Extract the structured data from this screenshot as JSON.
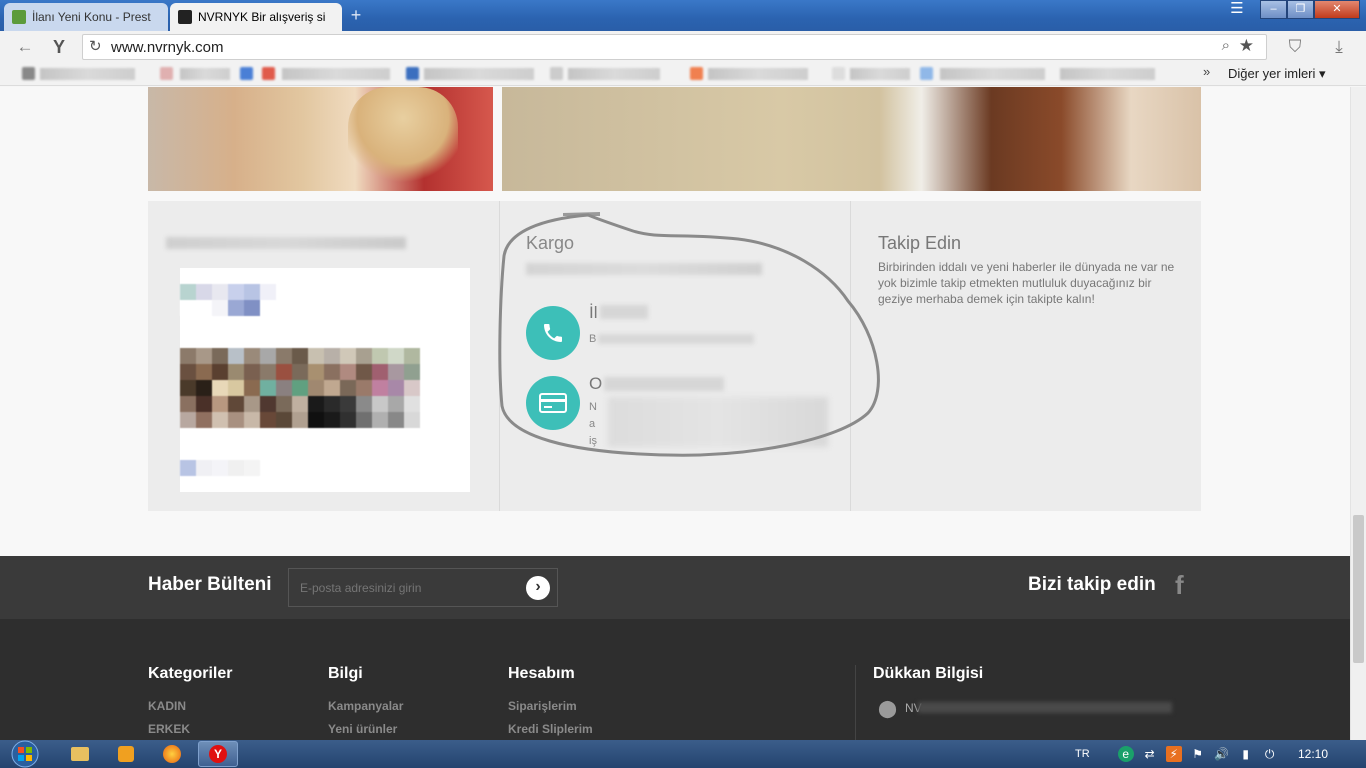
{
  "browser": {
    "tabs": [
      {
        "title": "İlanı Yeni Konu - Prest",
        "active": false
      },
      {
        "title": "NVRNYK Bir alışveriş si",
        "active": true
      }
    ],
    "url": "www.nvrnyk.com",
    "bookmarks_more": "Diğer yer imleri ▾"
  },
  "info": {
    "kargo_title": "Kargo",
    "phone_heading": "İl",
    "phone_text": "B",
    "card_heading": "O",
    "card_lines": [
      "N",
      "a",
      "iş"
    ],
    "takip_title": "Takip Edin",
    "takip_text": "Birbirinden iddalı ve yeni haberler ile dünyada ne var ne yok bizimle takip etmekten mutluluk duyacağınız bir geziye merhaba demek için takipte kalın!"
  },
  "newsletter": {
    "label": "Haber Bülteni",
    "placeholder": "E-posta adresinizi girin",
    "follow_label": "Bizi takip edin",
    "fb_icon": "f"
  },
  "footer": {
    "columns": [
      {
        "title": "Kategoriler",
        "links": [
          "KADIN",
          "ERKEK"
        ]
      },
      {
        "title": "Bilgi",
        "links": [
          "Kampanyalar",
          "Yeni ürünler"
        ]
      },
      {
        "title": "Hesabım",
        "links": [
          "Siparişlerim",
          "Kredi Sliplerim"
        ]
      },
      {
        "title": "Dükkan Bilgisi",
        "links": [
          "NV"
        ]
      }
    ]
  },
  "taskbar": {
    "lang": "TR",
    "time": "12:10"
  },
  "colors": {
    "accent_teal": "#3dbfb8",
    "footer_dark": "#2e2e2e",
    "newsletter_dark": "#3a3a3a"
  }
}
